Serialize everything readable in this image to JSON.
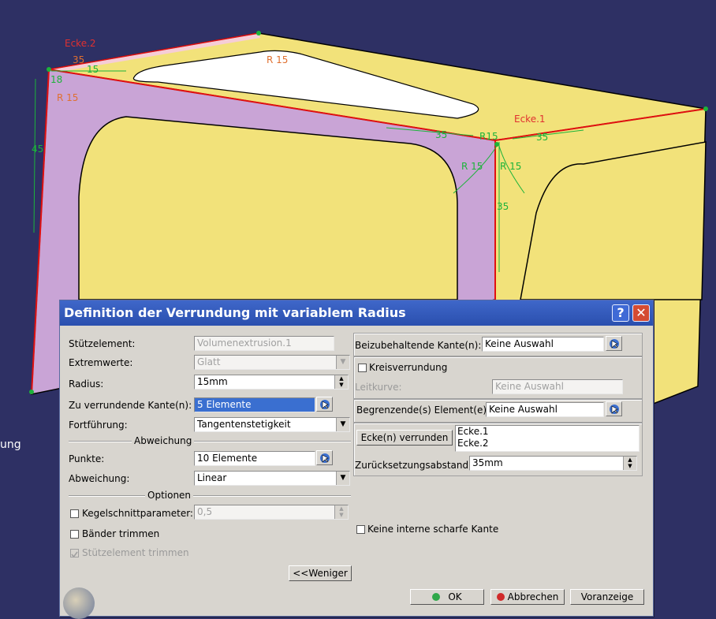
{
  "viewport": {
    "side_label": "ung",
    "annotations": {
      "corner2": "Ecke.2",
      "corner1": "Ecke.1",
      "r15": "R 15",
      "d35": "35",
      "d15": "15",
      "d45": "45",
      "r15_short": "R15",
      "d18": "18"
    }
  },
  "dialog": {
    "title": "Definition der Verrundung mit variablem Radius",
    "help_label": "?",
    "close_label": "✕",
    "left": {
      "support_label": "Stützelement:",
      "support_value": "Volumenextrusion.1",
      "extremes_label": "Extremwerte:",
      "extremes_value": "Glatt",
      "radius_label": "Radius:",
      "radius_value": "15mm",
      "edges_label": "Zu verrundende Kante(n):",
      "edges_value": "5 Elemente",
      "propagation_label": "Fortführung:",
      "propagation_value": "Tangentenstetigkeit",
      "deviation_section": "Abweichung",
      "points_label": "Punkte:",
      "points_value": "10 Elemente",
      "deviation_label": "Abweichung:",
      "deviation_value": "Linear",
      "options_section": "Optionen",
      "conic_label": "Kegelschnittparameter:",
      "conic_value": "0,5",
      "trim_ribbons_label": "Bänder trimmen",
      "trim_support_label": "Stützelement trimmen",
      "less_button": "<<Weniger"
    },
    "right": {
      "keep_edges_label": "Beizubehaltende Kante(n):",
      "keep_edges_value": "Keine Auswahl",
      "circle_fillet_label": "Kreisverrundung",
      "spine_label": "Leitkurve:",
      "spine_value": "Keine Auswahl",
      "limiting_label": "Begrenzende(s) Element(e):",
      "limiting_value": "Keine Auswahl",
      "corner_button": "Ecke(n) verrunden",
      "corners": [
        "Ecke.1",
        "Ecke.2"
      ],
      "setback_label": "Zurücksetzungsabstand:",
      "setback_value": "35mm",
      "no_sharp_label": "Keine interne scharfe Kante"
    },
    "footer": {
      "ok": "OK",
      "cancel": "Abbrechen",
      "preview": "Voranzeige"
    }
  },
  "colors": {
    "background": "#2e3064",
    "face_yellow": "#f2e27a",
    "face_purple": "#c9a4d6",
    "dialog_title": "#2f58bb",
    "selection": "#3a6fd0"
  },
  "icons": {
    "pick": "selection-cursor-icon",
    "ok": "green-dot-icon",
    "cancel": "red-dot-icon"
  }
}
